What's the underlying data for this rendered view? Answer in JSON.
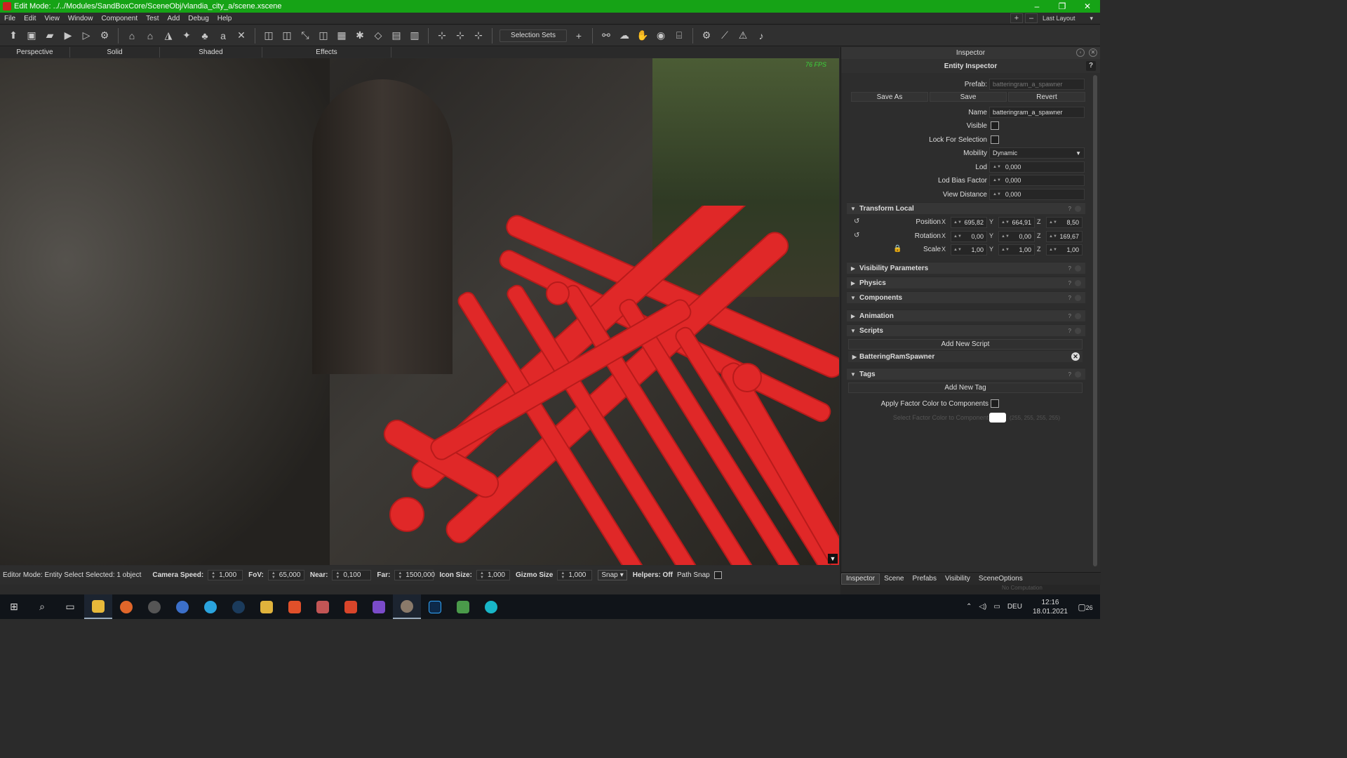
{
  "window": {
    "title": "Edit Mode: ../../Modules/SandBoxCore/SceneObj/vlandia_city_a/scene.xscene",
    "minimize": "–",
    "maximize": "❐",
    "close": "✕"
  },
  "menu": [
    "File",
    "Edit",
    "View",
    "Window",
    "Component",
    "Test",
    "Add",
    "Debug",
    "Help"
  ],
  "menu_right": {
    "plus": "+",
    "minus": "–",
    "layout": "Last Layout"
  },
  "toolbar": {
    "selection_sets": "Selection Sets",
    "add": "+"
  },
  "view_tabs": [
    "Perspective",
    "Solid",
    "Shaded",
    "Effects"
  ],
  "viewport": {
    "fps": "76 FPS",
    "corner_arrow": "▼"
  },
  "status": {
    "mode": "Editor Mode:",
    "mode_value": "Entity Select",
    "selected": "Selected: 1 object",
    "camera_speed_label": "Camera Speed:",
    "camera_speed": "1,000",
    "fov_label": "FoV:",
    "fov": "65,000",
    "near_label": "Near:",
    "near": "0,100",
    "far_label": "Far:",
    "far": "1500,000",
    "icon_size_label": "Icon Size:",
    "icon_size": "1,000",
    "gizmo_size_label": "Gizmo Size",
    "gizmo_size": "1,000",
    "snap": "Snap",
    "helpers": "Helpers: Off",
    "path_snap": "Path Snap"
  },
  "inspector": {
    "title": "Inspector",
    "entity_title": "Entity Inspector",
    "help": "?",
    "prefab_label": "Prefab:",
    "prefab_value": "batteringram_a_spawner",
    "buttons": {
      "save_as": "Save As",
      "save": "Save",
      "revert": "Revert"
    },
    "name_label": "Name",
    "name_value": "batteringram_a_spawner",
    "visible_label": "Visible",
    "lock_label": "Lock For Selection",
    "mobility_label": "Mobility",
    "mobility_value": "Dynamic",
    "lod_label": "Lod",
    "lod_value": "0,000",
    "lod_bias_label": "Lod Bias Factor",
    "lod_bias_value": "0,000",
    "view_distance_label": "View Distance",
    "view_distance_value": "0,000",
    "transform": {
      "title": "Transform Local",
      "position_label": "Position",
      "position": {
        "x": "695,82",
        "y": "664,91",
        "z": "8,50"
      },
      "rotation_label": "Rotation",
      "rotation": {
        "x": "0,00",
        "y": "0,00",
        "z": "169,67"
      },
      "scale_label": "Scale",
      "scale": {
        "x": "1,00",
        "y": "1,00",
        "z": "1,00"
      },
      "axis_x": "X",
      "axis_y": "Y",
      "axis_z": "Z"
    },
    "sections": {
      "visibility": "Visibility Parameters",
      "physics": "Physics",
      "components": "Components",
      "animation": "Animation",
      "scripts": "Scripts",
      "tags": "Tags"
    },
    "add_new_script": "Add New Script",
    "script_item": "BatteringRamSpawner",
    "add_new_tag": "Add New Tag",
    "apply_factor": "Apply Factor Color to Components",
    "select_factor": "Select Factor Color to Component",
    "factor_rgba": "(255, 255, 255, 255)",
    "factor_color": "#ffffff"
  },
  "bottom_tabs": [
    "Inspector",
    "Scene",
    "Prefabs",
    "Visibility",
    "SceneOptions"
  ],
  "under_bar": "No Computation",
  "taskbar": {
    "language": "DEU",
    "time": "12:16",
    "date": "18.01.2021",
    "notifications": "26"
  },
  "colors": {
    "titlebar": "#16a316",
    "highlight": "#e02828",
    "fps": "#3cd33c"
  }
}
